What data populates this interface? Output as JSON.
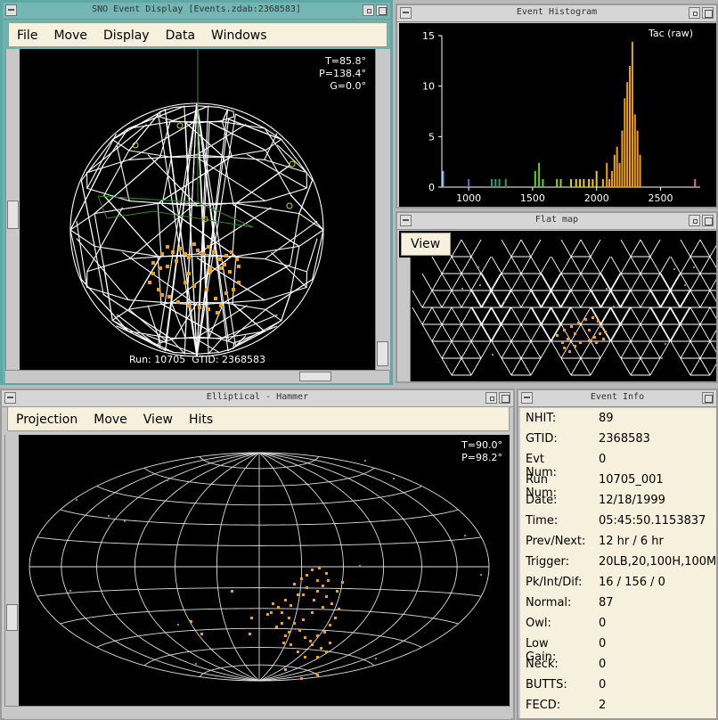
{
  "event_display": {
    "title": "SNO Event Display [Events.zdab:2368583]",
    "menu": [
      "File",
      "Move",
      "Display",
      "Data",
      "Windows"
    ],
    "angles": [
      "T=85.8°",
      "P=138.4°",
      "G=0.0°"
    ],
    "status": "Run: 10705  GTID: 2368583"
  },
  "histogram": {
    "title": "Event Histogram",
    "label": "Tac (raw)"
  },
  "flat_map": {
    "title": "Flat map",
    "view_button": "View"
  },
  "hammer": {
    "title": "Elliptical - Hammer",
    "menu": [
      "Projection",
      "Move",
      "View",
      "Hits"
    ],
    "angles": [
      "T=90.0°",
      "P=98.2°"
    ]
  },
  "event_info": {
    "title": "Event Info",
    "rows": [
      {
        "k": "NHIT:",
        "v": "89"
      },
      {
        "k": "GTID:",
        "v": "2368583"
      },
      {
        "k": "Evt Num:",
        "v": "0"
      },
      {
        "k": "Run Num:",
        "v": "10705_001"
      },
      {
        "k": "Date:",
        "v": "12/18/1999"
      },
      {
        "k": "Time:",
        "v": "05:45:50.1153837"
      },
      {
        "k": "Prev/Next:",
        "v": "12 hr / 6 hr"
      },
      {
        "k": "Trigger:",
        "v": "20LB,20,100H,100M"
      },
      {
        "k": "Pk/Int/Dif:",
        "v": "16 / 156 / 0"
      },
      {
        "k": "Normal:",
        "v": "87"
      },
      {
        "k": "Owl:",
        "v": "0"
      },
      {
        "k": "Low Gain:",
        "v": "0"
      },
      {
        "k": "Neck:",
        "v": "0"
      },
      {
        "k": "BUTTS:",
        "v": "0"
      },
      {
        "k": "FECD:",
        "v": "2"
      }
    ]
  },
  "chart_data": {
    "type": "bar",
    "title": "Tac (raw)",
    "xlim": [
      790,
      2810
    ],
    "ylim": [
      0,
      15
    ],
    "xticks": [
      1000,
      1500,
      2000,
      2500
    ],
    "yticks": [
      0,
      5,
      10,
      15
    ],
    "bars": [
      {
        "x": 800,
        "y": 1.6,
        "c": "#6fa8d8"
      },
      {
        "x": 1000,
        "y": 0.8,
        "c": "#4a78c8"
      },
      {
        "x": 1180,
        "y": 0.8,
        "c": "#2a9a6a"
      },
      {
        "x": 1210,
        "y": 0.8,
        "c": "#2a9a6a"
      },
      {
        "x": 1240,
        "y": 0.8,
        "c": "#2a9a6a"
      },
      {
        "x": 1290,
        "y": 0.8,
        "c": "#2a9a6a"
      },
      {
        "x": 1520,
        "y": 1.6,
        "c": "#6acc3a"
      },
      {
        "x": 1550,
        "y": 2.4,
        "c": "#6acc3a"
      },
      {
        "x": 1580,
        "y": 0.8,
        "c": "#6acc3a"
      },
      {
        "x": 1690,
        "y": 0.8,
        "c": "#9ad030"
      },
      {
        "x": 1720,
        "y": 0.8,
        "c": "#9ad030"
      },
      {
        "x": 1800,
        "y": 0.8,
        "c": "#c8d020"
      },
      {
        "x": 1840,
        "y": 0.8,
        "c": "#e0d020"
      },
      {
        "x": 1870,
        "y": 0.8,
        "c": "#e0d020"
      },
      {
        "x": 1900,
        "y": 0.8,
        "c": "#e0d020"
      },
      {
        "x": 1940,
        "y": 0.8,
        "c": "#f0c820"
      },
      {
        "x": 1970,
        "y": 0.8,
        "c": "#f0c820"
      },
      {
        "x": 2000,
        "y": 1.6,
        "c": "#f0c820"
      },
      {
        "x": 2050,
        "y": 0.8,
        "c": "#f0b020"
      },
      {
        "x": 2080,
        "y": 2.4,
        "c": "#f0a020"
      },
      {
        "x": 2100,
        "y": 0.8,
        "c": "#f0a020"
      },
      {
        "x": 2120,
        "y": 1.6,
        "c": "#f0a020"
      },
      {
        "x": 2140,
        "y": 3.2,
        "c": "#f0a020"
      },
      {
        "x": 2160,
        "y": 4.0,
        "c": "#f0a020"
      },
      {
        "x": 2180,
        "y": 2.4,
        "c": "#f0a020"
      },
      {
        "x": 2200,
        "y": 5.6,
        "c": "#f0a020"
      },
      {
        "x": 2220,
        "y": 8.8,
        "c": "#f0a020"
      },
      {
        "x": 2240,
        "y": 10.4,
        "c": "#f0a020"
      },
      {
        "x": 2260,
        "y": 12.0,
        "c": "#f0a020"
      },
      {
        "x": 2280,
        "y": 14.4,
        "c": "#f0a020"
      },
      {
        "x": 2300,
        "y": 7.2,
        "c": "#f0a020"
      },
      {
        "x": 2320,
        "y": 5.6,
        "c": "#f0a020"
      },
      {
        "x": 2340,
        "y": 3.2,
        "c": "#f0a020"
      },
      {
        "x": 2770,
        "y": 0.8,
        "c": "#e87070"
      }
    ]
  }
}
